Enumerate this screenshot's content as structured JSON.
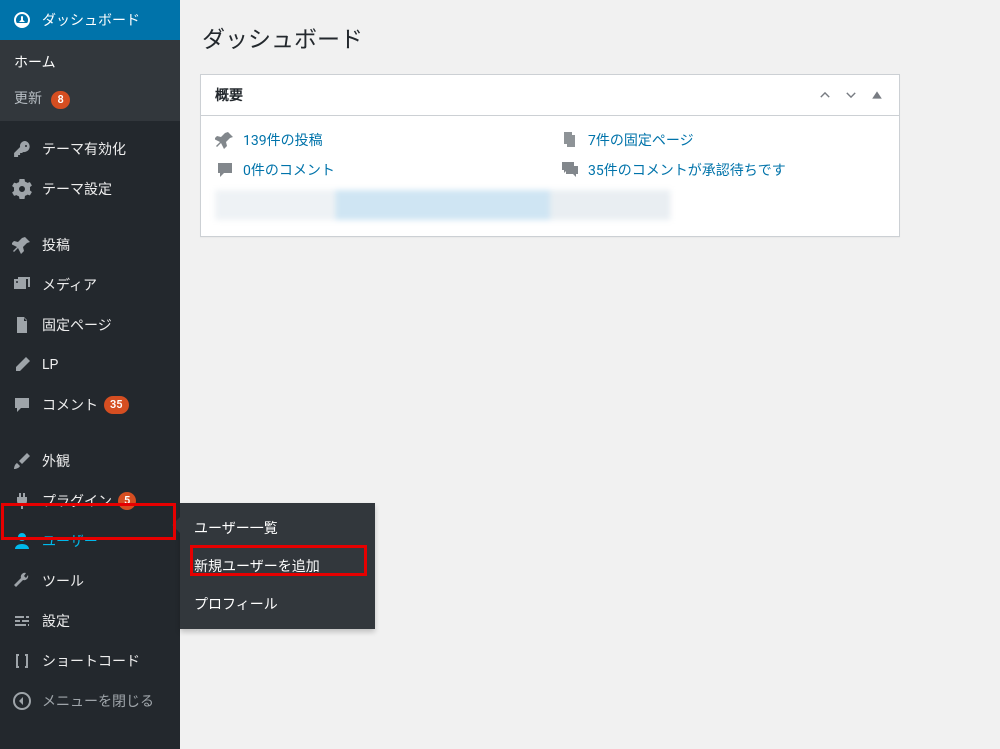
{
  "sidebar": {
    "dashboard": "ダッシュボード",
    "home": "ホーム",
    "updates": "更新",
    "updates_badge": "8",
    "theme_activate": "テーマ有効化",
    "theme_settings": "テーマ設定",
    "posts": "投稿",
    "media": "メディア",
    "pages": "固定ページ",
    "lp": "LP",
    "comments": "コメント",
    "comments_badge": "35",
    "appearance": "外観",
    "plugins": "プラグイン",
    "plugins_badge": "5",
    "users": "ユーザー",
    "tools": "ツール",
    "settings": "設定",
    "shortcode": "ショートコード",
    "collapse": "メニューを閉じる"
  },
  "flyout": {
    "users_list": "ユーザー一覧",
    "add_new_user": "新規ユーザーを追加",
    "profile": "プロフィール"
  },
  "main": {
    "title": "ダッシュボード",
    "panel_title": "概要",
    "stats": {
      "posts": "139件の投稿",
      "pages": "7件の固定ページ",
      "comments": "0件のコメント",
      "pending": "35件のコメントが承認待ちです"
    }
  }
}
